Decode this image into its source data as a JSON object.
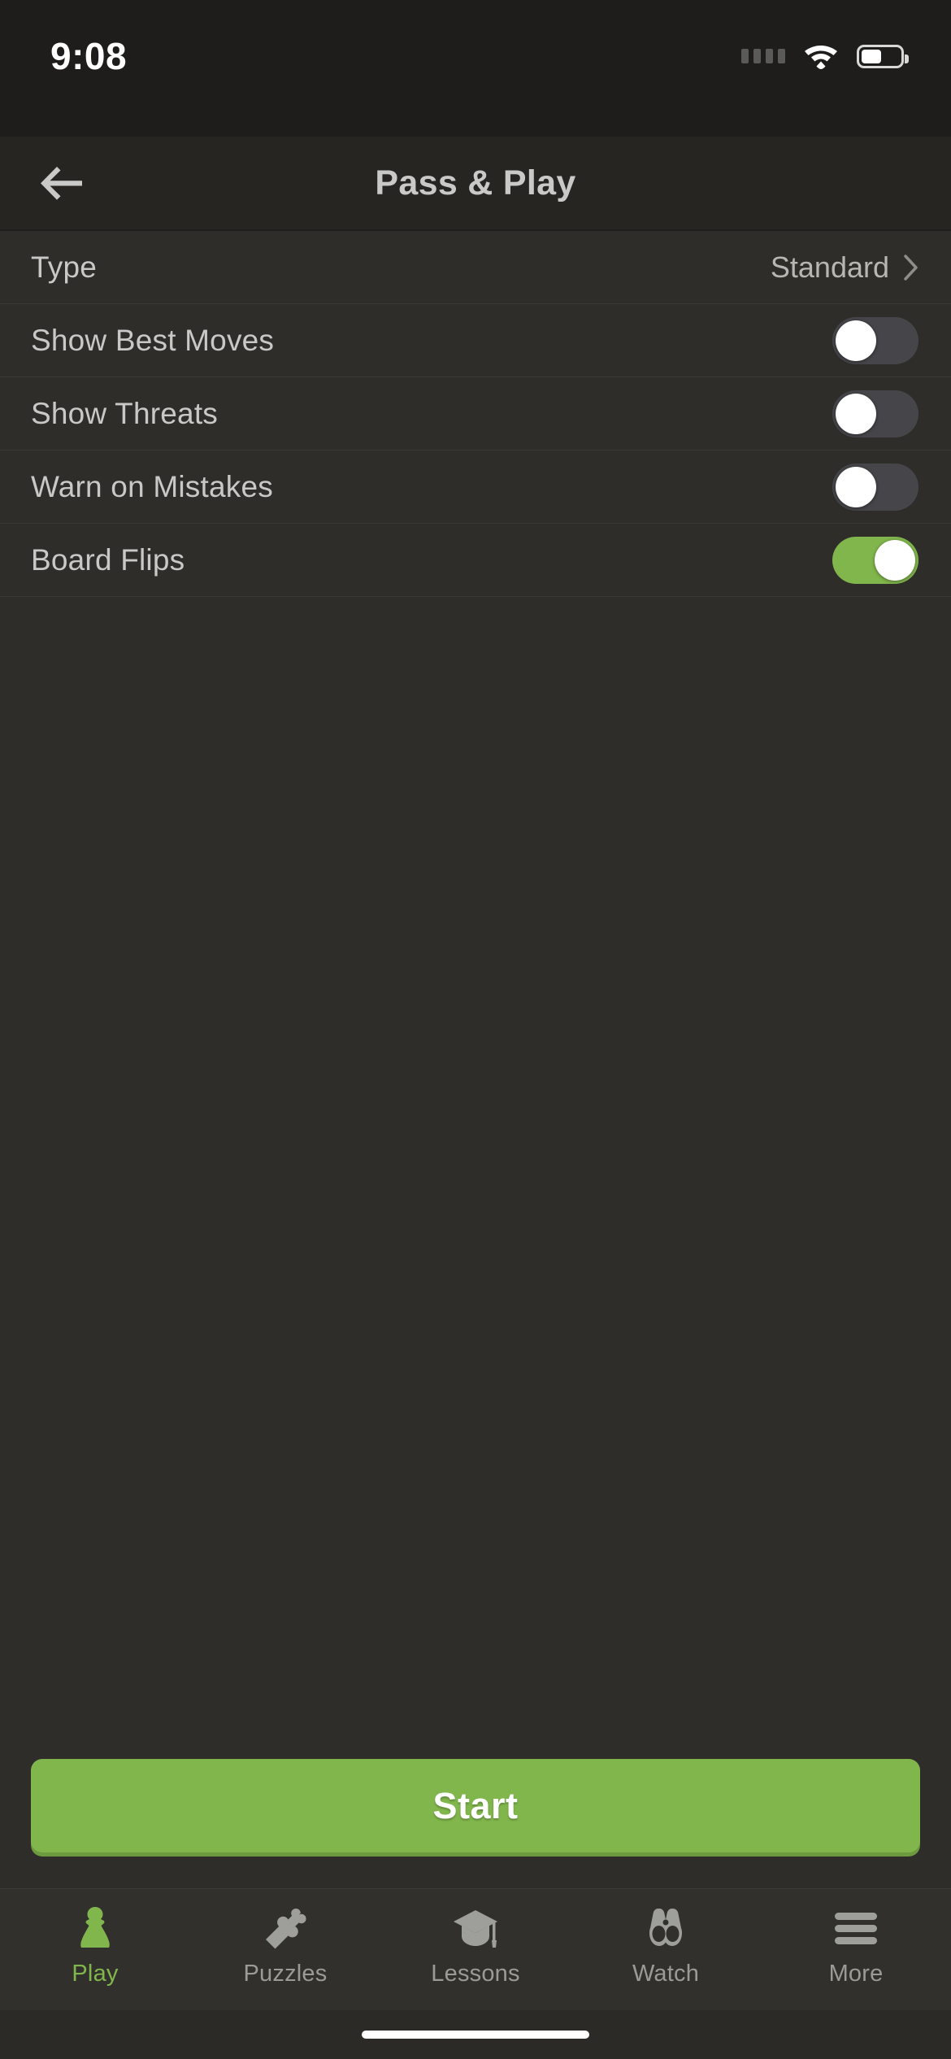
{
  "status_bar": {
    "time": "9:08",
    "signal_icon": "signal-dots-icon",
    "wifi_icon": "wifi-icon",
    "battery_icon": "battery-icon",
    "battery_level_percent": 52
  },
  "nav": {
    "back_icon": "back-arrow-icon",
    "title": "Pass & Play"
  },
  "settings": {
    "type_row": {
      "label": "Type",
      "value": "Standard",
      "chevron_icon": "chevron-right-icon"
    },
    "toggles": [
      {
        "label": "Show Best Moves",
        "value": "off"
      },
      {
        "label": "Show Threats",
        "value": "off"
      },
      {
        "label": "Warn on Mistakes",
        "value": "off"
      },
      {
        "label": "Board Flips",
        "value": "on"
      }
    ]
  },
  "action": {
    "start_label": "Start"
  },
  "tabbar": {
    "items": [
      {
        "label": "Play",
        "icon": "chess-pawn-icon",
        "active": true
      },
      {
        "label": "Puzzles",
        "icon": "puzzle-piece-icon",
        "active": false
      },
      {
        "label": "Lessons",
        "icon": "graduation-cap-icon",
        "active": false
      },
      {
        "label": "Watch",
        "icon": "binoculars-icon",
        "active": false
      },
      {
        "label": "More",
        "icon": "hamburger-menu-icon",
        "active": false
      }
    ]
  },
  "colors": {
    "accent_green": "#81b64c",
    "background": "#2e2d2a",
    "nav_background": "#262522",
    "status_background": "#1e1d1b",
    "text_primary": "#c8c8c6",
    "toggle_off_track": "#46464a"
  }
}
